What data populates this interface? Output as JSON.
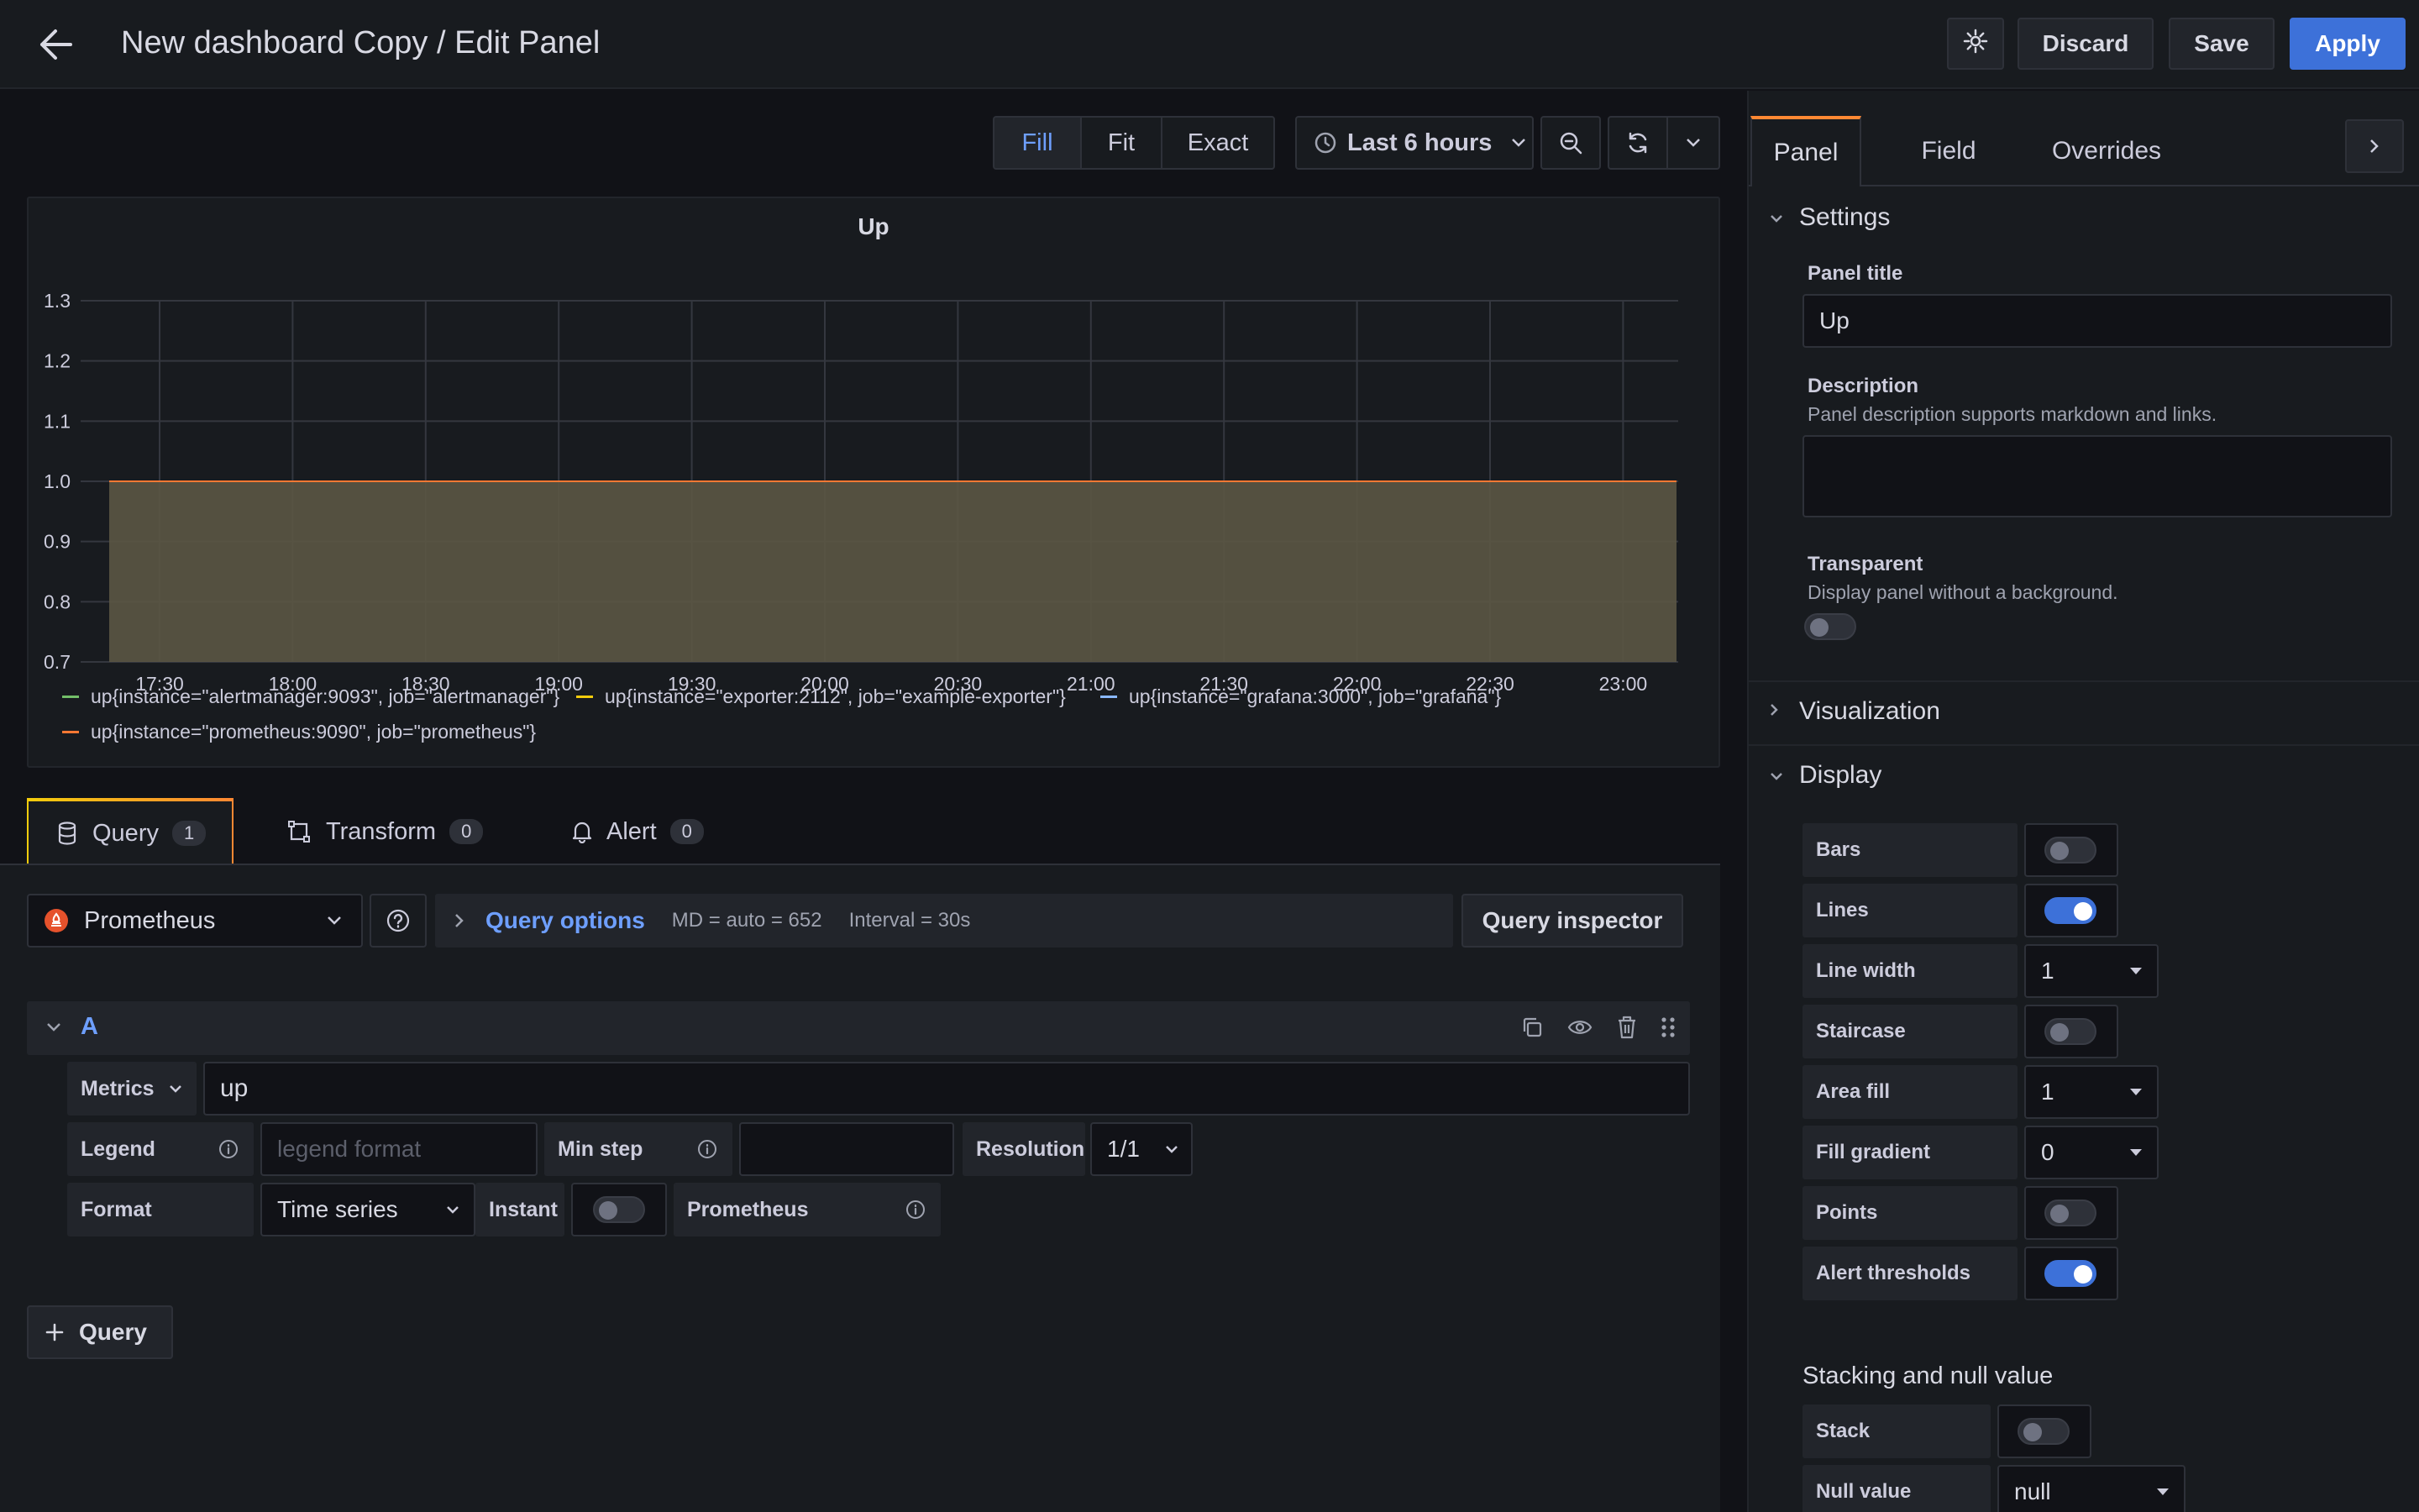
{
  "header": {
    "title": "New dashboard Copy / Edit Panel",
    "discard_label": "Discard",
    "save_label": "Save",
    "apply_label": "Apply"
  },
  "toolbar": {
    "fill_label": "Fill",
    "fit_label": "Fit",
    "exact_label": "Exact",
    "time_range": "Last 6 hours"
  },
  "chart_data": {
    "type": "area",
    "title": "Up",
    "x": [
      "17:30",
      "18:00",
      "18:30",
      "19:00",
      "19:30",
      "20:00",
      "20:30",
      "21:00",
      "21:30",
      "22:00",
      "22:30",
      "23:00"
    ],
    "yticks": [
      "1.3",
      "1.2",
      "1.1",
      "1.0",
      "0.9",
      "0.8",
      "0.7"
    ],
    "ylim": [
      0.7,
      1.3
    ],
    "series": [
      {
        "name": "up{instance=\"alertmanager:9093\", job=\"alertmanager\"}",
        "color": "#73bf69",
        "values": [
          1,
          1,
          1,
          1,
          1,
          1,
          1,
          1,
          1,
          1,
          1,
          1
        ]
      },
      {
        "name": "up{instance=\"exporter:2112\", job=\"example-exporter\"}",
        "color": "#f2cc0c",
        "values": [
          1,
          1,
          1,
          1,
          1,
          1,
          1,
          1,
          1,
          1,
          1,
          1
        ]
      },
      {
        "name": "up{instance=\"grafana:3000\", job=\"grafana\"}",
        "color": "#8ab8ff",
        "values": [
          1,
          1,
          1,
          1,
          1,
          1,
          1,
          1,
          1,
          1,
          1,
          1
        ]
      },
      {
        "name": "up{instance=\"prometheus:9090\", job=\"prometheus\"}",
        "color": "#ff7833",
        "values": [
          1,
          1,
          1,
          1,
          1,
          1,
          1,
          1,
          1,
          1,
          1,
          1
        ]
      }
    ],
    "grid": true,
    "legend": "bottom"
  },
  "query_tabs": {
    "query_label": "Query",
    "query_count": "1",
    "transform_label": "Transform",
    "transform_count": "0",
    "alert_label": "Alert",
    "alert_count": "0"
  },
  "query_bar": {
    "datasource": "Prometheus",
    "options_label": "Query options",
    "md_info": "MD = auto = 652",
    "interval_info": "Interval = 30s",
    "inspector_label": "Query inspector"
  },
  "query_row": {
    "ref_id": "A",
    "metrics_label": "Metrics",
    "metrics_value": "up",
    "legend_label": "Legend",
    "legend_placeholder": "legend format",
    "min_step_label": "Min step",
    "resolution_label": "Resolution",
    "resolution_value": "1/1",
    "format_label": "Format",
    "format_value": "Time series",
    "instant_label": "Instant",
    "instant_on": false,
    "prom_label": "Prometheus",
    "add_query_label": "Query"
  },
  "right_panel": {
    "tabs": [
      "Panel",
      "Field",
      "Overrides"
    ],
    "settings_heading": "Settings",
    "panel_title_label": "Panel title",
    "panel_title_value": "Up",
    "description_label": "Description",
    "description_hint": "Panel description supports markdown and links.",
    "transparent_label": "Transparent",
    "transparent_hint": "Display panel without a background.",
    "transparent_on": false,
    "visualization_heading": "Visualization",
    "display_heading": "Display",
    "display_options": [
      {
        "label": "Bars",
        "type": "toggle",
        "on": false
      },
      {
        "label": "Lines",
        "type": "toggle",
        "on": true
      },
      {
        "label": "Line width",
        "type": "select",
        "value": "1"
      },
      {
        "label": "Staircase",
        "type": "toggle",
        "on": false
      },
      {
        "label": "Area fill",
        "type": "select",
        "value": "1"
      },
      {
        "label": "Fill gradient",
        "type": "select",
        "value": "0"
      },
      {
        "label": "Points",
        "type": "toggle",
        "on": false
      },
      {
        "label": "Alert thresholds",
        "type": "toggle",
        "on": true
      }
    ],
    "stacking_heading": "Stacking and null value",
    "stack_label": "Stack",
    "stack_on": false,
    "null_value_label": "Null value",
    "null_value": "null"
  },
  "colors": {
    "accent": "#3d71d9",
    "link": "#6e9fff",
    "tab_accent": "#ff8833"
  }
}
